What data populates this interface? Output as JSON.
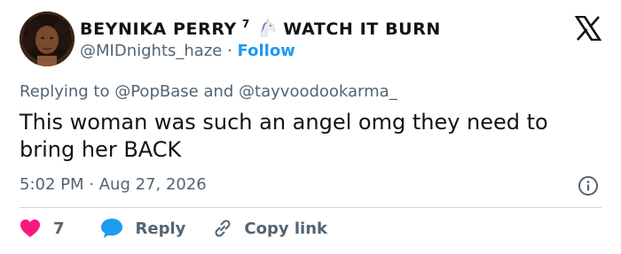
{
  "author": {
    "display_name": "BEYNIKA PERRY",
    "superscript": "7",
    "emoji": "unicorn-icon",
    "display_name_suffix": "WATCH IT BURN",
    "handle": "@MIDnights_haze",
    "separator": "·",
    "follow_label": "Follow"
  },
  "reply_context": {
    "prefix": "Replying to",
    "mention_1": "@PopBase",
    "conjunction": "and",
    "mention_2": "@tayvoodookarma_"
  },
  "tweet": {
    "text_line_1": "This woman was such an angel omg they need to",
    "text_line_2": "bring her BACK",
    "time": "5:02 PM",
    "separator": "·",
    "date": "Aug 27, 2026"
  },
  "actions": {
    "like_count": "7",
    "reply_label": "Reply",
    "copy_link_label": "Copy link"
  },
  "colors": {
    "like": "#f91880",
    "reply": "#1d9bf0",
    "follow": "#1d9bf0",
    "muted": "#536471",
    "text": "#0f1419"
  },
  "icons": [
    "x-logo-icon",
    "unicorn-icon",
    "heart-icon",
    "reply-bubble-icon",
    "link-icon",
    "info-icon"
  ]
}
